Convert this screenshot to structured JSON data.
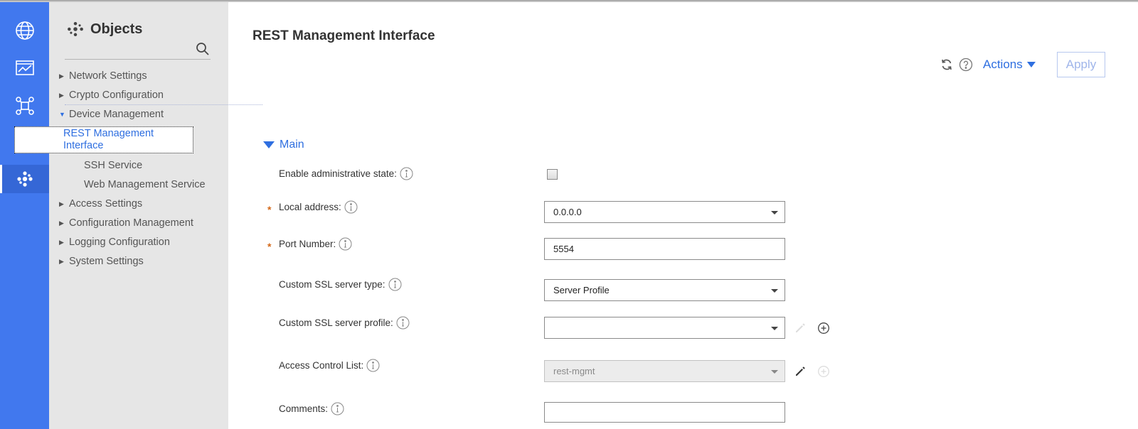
{
  "rail": {
    "items": [
      {
        "icon": "globe-icon"
      },
      {
        "icon": "monitor-chart-icon"
      },
      {
        "icon": "network-icon"
      },
      {
        "icon": "gear-icon"
      },
      {
        "icon": "objects-dots-icon",
        "active": true
      }
    ]
  },
  "tree": {
    "title": "Objects",
    "items": [
      {
        "label": "Network Settings",
        "expanded": false
      },
      {
        "label": "Crypto Configuration",
        "expanded": false
      },
      {
        "label": "Device Management",
        "expanded": true
      },
      {
        "label": "REST Management Interface",
        "selected": true
      },
      {
        "label": "SSH Service"
      },
      {
        "label": "Web Management Service"
      },
      {
        "label": "Access Settings",
        "expanded": false
      },
      {
        "label": "Configuration Management",
        "expanded": false
      },
      {
        "label": "Logging Configuration",
        "expanded": false
      },
      {
        "label": "System Settings",
        "expanded": false
      }
    ]
  },
  "main": {
    "title": "REST Management Interface",
    "actions_label": "Actions",
    "apply_label": "Apply",
    "section_label": "Main",
    "fields": {
      "enable_state": {
        "label": "Enable administrative state:",
        "checked": false
      },
      "local_address": {
        "label": "Local address:",
        "value": "0.0.0.0",
        "required": true
      },
      "port_number": {
        "label": "Port Number:",
        "value": "5554",
        "required": true
      },
      "ssl_type": {
        "label": "Custom SSL server type:",
        "value": "Server Profile"
      },
      "ssl_profile": {
        "label": "Custom SSL server profile:",
        "value": ""
      },
      "acl": {
        "label": "Access Control List:",
        "value": "rest-mgmt",
        "disabled": true
      },
      "comments": {
        "label": "Comments:",
        "value": ""
      }
    },
    "required_mark": "*"
  },
  "colors": {
    "rail": "#4178ee",
    "tree_bg": "#e6e6e6",
    "accent": "#2f6fe0",
    "required": "#d4691a"
  }
}
